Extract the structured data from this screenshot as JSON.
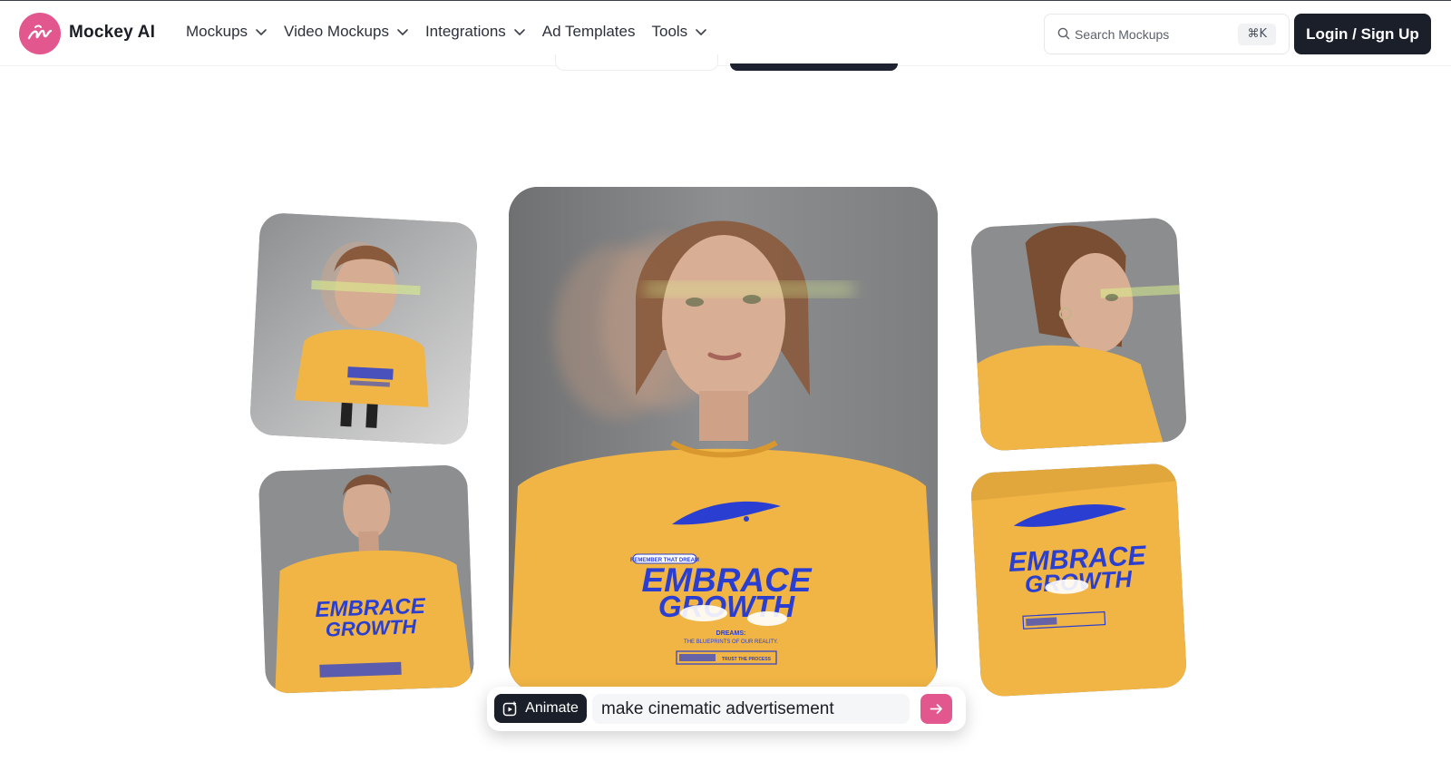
{
  "header": {
    "brand": "Mockey AI",
    "nav": [
      {
        "label": "Mockups",
        "has_dropdown": true
      },
      {
        "label": "Video Mockups",
        "has_dropdown": true
      },
      {
        "label": "Integrations",
        "has_dropdown": true
      },
      {
        "label": "Ad Templates",
        "has_dropdown": false
      },
      {
        "label": "Tools",
        "has_dropdown": true
      }
    ],
    "search": {
      "placeholder": "Search Mockups",
      "shortcut": "⌘K"
    },
    "login_label": "Login / Sign Up"
  },
  "gallery": {
    "shirt_text": {
      "tagline": "REMEMBER THAT DREAM",
      "line1": "EMBRACE",
      "line2": "GROWTH",
      "sub1": "DREAMS:",
      "sub2": "THE BLUEPRINTS OF OUR REALITY.",
      "badge": "TRUST THE PROCESS"
    }
  },
  "prompt_bar": {
    "animate_label": "Animate",
    "input_value": "make cinematic advertisement"
  },
  "colors": {
    "accent": "#e3578f",
    "dark": "#1b1f2a",
    "shirt": "#f0b545",
    "print": "#2a3fd1",
    "backdrop": "#8a8b8d"
  },
  "icons": {
    "logo": "mockey-logo-icon",
    "chevron": "chevron-down-icon",
    "search": "search-icon",
    "animate": "animate-icon",
    "send": "arrow-right-icon"
  }
}
